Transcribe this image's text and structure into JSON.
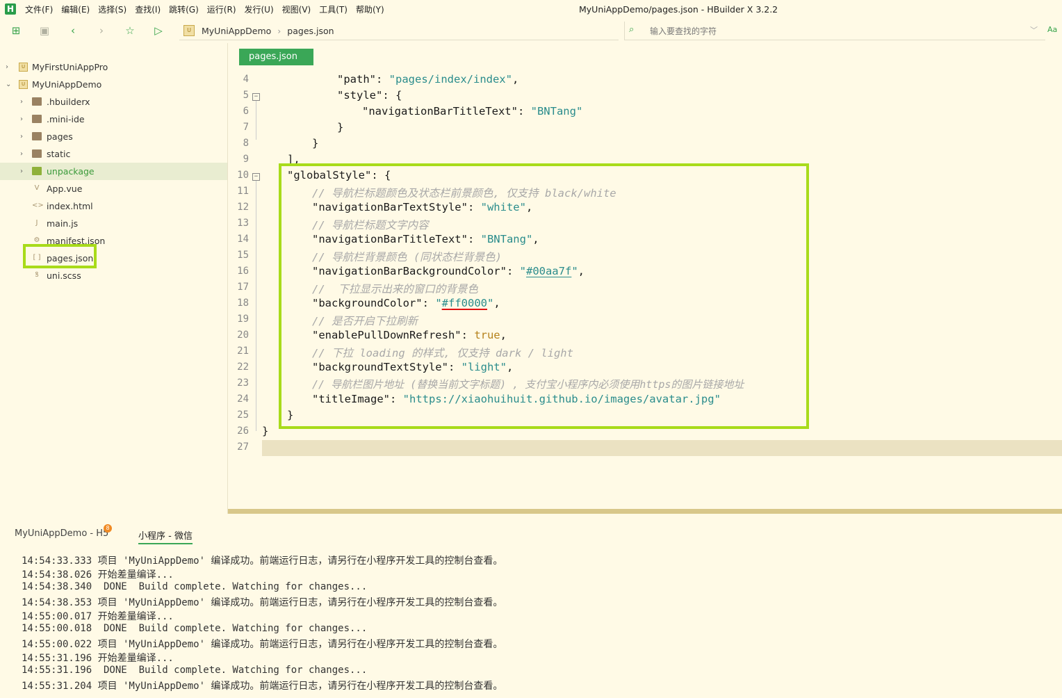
{
  "app": {
    "logo": "H",
    "window_title": "MyUniAppDemo/pages.json - HBuilder X 3.2.2",
    "menu": [
      "文件(F)",
      "编辑(E)",
      "选择(S)",
      "查找(I)",
      "跳转(G)",
      "运行(R)",
      "发行(U)",
      "视图(V)",
      "工具(T)",
      "帮助(Y)"
    ]
  },
  "toolbar": {
    "breadcrumb": [
      "MyUniAppDemo",
      "pages.json"
    ],
    "search_placeholder": "输入要查找的字符",
    "case_label": "Aa"
  },
  "sidebar": {
    "items": [
      {
        "label": "MyFirstUniAppPro",
        "icon": "project-icon"
      },
      {
        "label": "MyUniAppDemo",
        "icon": "project-icon"
      },
      {
        "label": ".hbuilderx",
        "icon": "folder-icon"
      },
      {
        "label": ".mini-ide",
        "icon": "folder-icon"
      },
      {
        "label": "pages",
        "icon": "folder-icon"
      },
      {
        "label": "static",
        "icon": "folder-icon"
      },
      {
        "label": "unpackage",
        "icon": "folder-icon"
      },
      {
        "label": "App.vue",
        "icon": "vue-file-icon"
      },
      {
        "label": "index.html",
        "icon": "html-file-icon"
      },
      {
        "label": "main.js",
        "icon": "js-file-icon"
      },
      {
        "label": "manifest.json",
        "icon": "manifest-file-icon"
      },
      {
        "label": "pages.json",
        "icon": "json-file-icon"
      },
      {
        "label": "uni.scss",
        "icon": "scss-file-icon"
      }
    ]
  },
  "editor": {
    "tab": "pages.json",
    "line_numbers": [
      "4",
      "5",
      "6",
      "7",
      "8",
      "9",
      "10",
      "11",
      "12",
      "13",
      "14",
      "15",
      "16",
      "17",
      "18",
      "19",
      "20",
      "21",
      "22",
      "23",
      "24",
      "25",
      "26",
      "27"
    ],
    "code": {
      "l4_key": "\"path\"",
      "l4_val": "\"pages/index/index\"",
      "l5_key": "\"style\"",
      "l6_key": "\"navigationBarTitleText\"",
      "l6_val": "\"BNTang\"",
      "l10_key": "\"globalStyle\"",
      "l11": "// 导航栏标题颜色及状态栏前景颜色, 仅支持 black/white",
      "l12_key": "\"navigationBarTextStyle\"",
      "l12_val": "\"white\"",
      "l13": "// 导航栏标题文字内容",
      "l14_key": "\"navigationBarTitleText\"",
      "l14_val": "\"BNTang\"",
      "l15": "// 导航栏背景颜色 (同状态栏背景色)",
      "l16_key": "\"navigationBarBackgroundColor\"",
      "l16_val": "#00aa7f",
      "l17": "//  下拉显示出来的窗口的背景色",
      "l18_key": "\"backgroundColor\"",
      "l18_val": "#ff0000",
      "l19": "// 是否开启下拉刷新",
      "l20_key": "\"enablePullDownRefresh\"",
      "l20_val": "true",
      "l21": "// 下拉 loading 的样式, 仅支持 dark / light",
      "l22_key": "\"backgroundTextStyle\"",
      "l22_val": "\"light\"",
      "l23": "// 导航栏图片地址 (替换当前文字标题) , 支付宝小程序内必须使用https的图片链接地址",
      "l24_key": "\"titleImage\"",
      "l24_val": "\"https://xiaohuihuit.github.io/images/avatar.jpg\""
    }
  },
  "console": {
    "tabs": [
      "MyUniAppDemo - H5",
      "小程序 - 微信"
    ],
    "badge": "8",
    "logs": [
      "14:54:33.333 项目 'MyUniAppDemo' 编译成功。前端运行日志，请另行在小程序开发工具的控制台查看。",
      "14:54:38.026 开始差量编译...",
      "14:54:38.340  DONE  Build complete. Watching for changes...",
      "14:54:38.353 项目 'MyUniAppDemo' 编译成功。前端运行日志，请另行在小程序开发工具的控制台查看。",
      "14:55:00.017 开始差量编译...",
      "14:55:00.018  DONE  Build complete. Watching for changes...",
      "14:55:00.022 项目 'MyUniAppDemo' 编译成功。前端运行日志，请另行在小程序开发工具的控制台查看。",
      "14:55:31.196 开始差量编译...",
      "14:55:31.196  DONE  Build complete. Watching for changes...",
      "14:55:31.204 项目 'MyUniAppDemo' 编译成功。前端运行日志，请另行在小程序开发工具的控制台查看。"
    ]
  },
  "colors": {
    "accent": "#3aa757",
    "highlight": "#a8db1a",
    "background": "#fffae6"
  }
}
